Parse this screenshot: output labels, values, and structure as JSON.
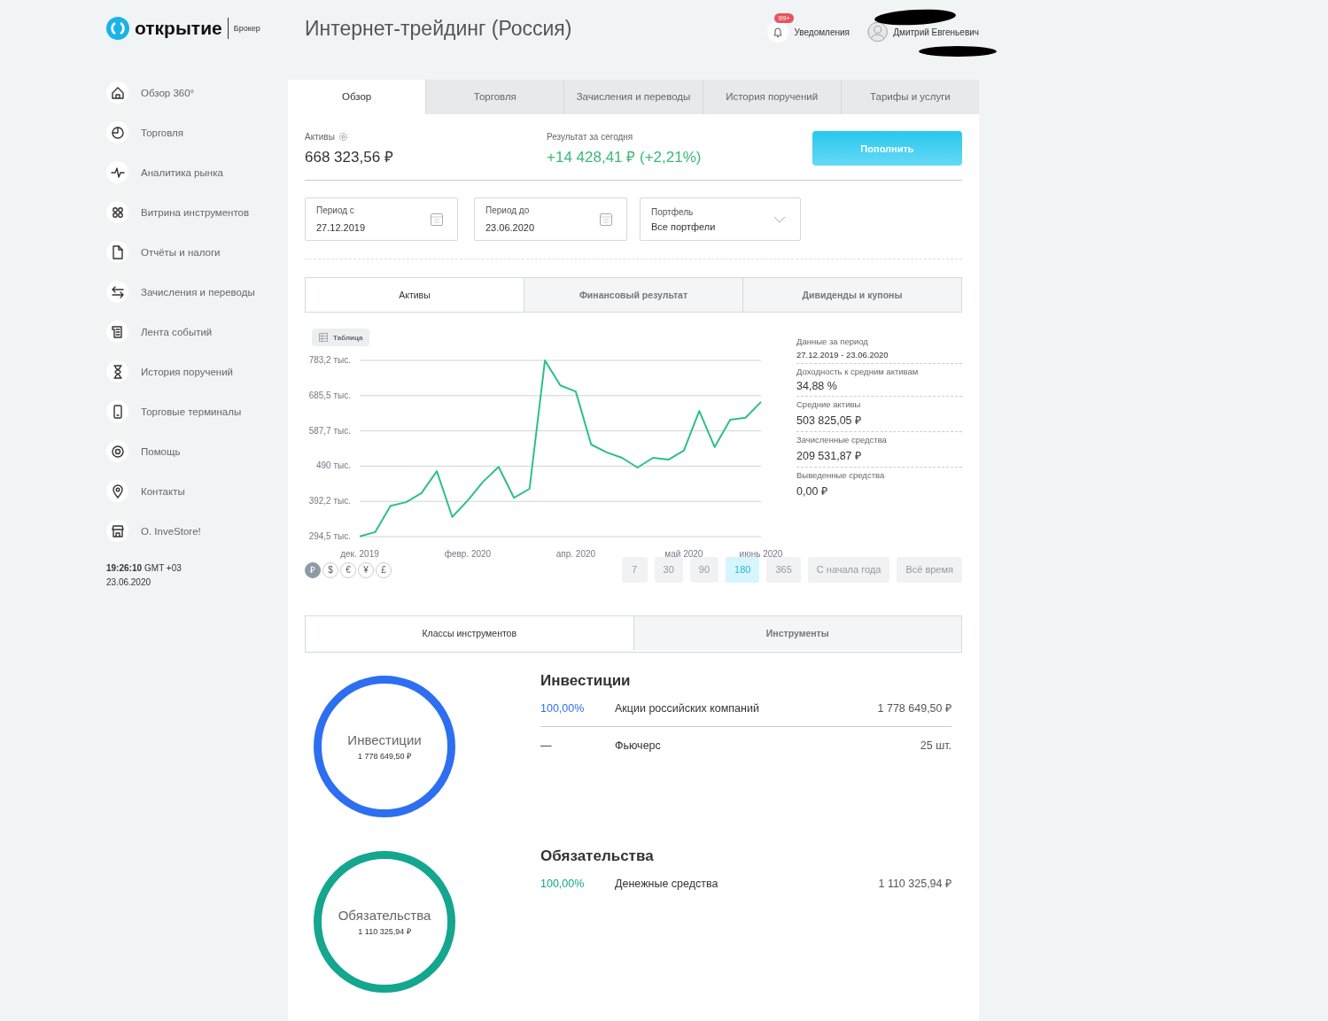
{
  "header": {
    "logo": "открытие",
    "logo_sub": "Брокер",
    "title": "Интернет-трейдинг (Россия)",
    "notifications": {
      "badge": "99+",
      "label": "Уведомления"
    },
    "user": {
      "name": "Дмитрий Евгеньевич"
    }
  },
  "sidebar": {
    "items": [
      {
        "label": "Обзор 360°"
      },
      {
        "label": "Торговля"
      },
      {
        "label": "Аналитика рынка"
      },
      {
        "label": "Витрина инструментов"
      },
      {
        "label": "Отчёты и налоги"
      },
      {
        "label": "Зачисления и переводы"
      },
      {
        "label": "Лента событий"
      },
      {
        "label": "История поручений"
      },
      {
        "label": "Торговые терминалы"
      },
      {
        "label": "Помощь"
      },
      {
        "label": "Контакты"
      },
      {
        "label": "O. InveStore!"
      }
    ],
    "time": "19:26:10",
    "zone": "GMT +03",
    "date": "23.06.2020"
  },
  "tabs": [
    {
      "label": "Обзор",
      "selected": true
    },
    {
      "label": "Торговля",
      "selected": false
    },
    {
      "label": "Зачисления и переводы",
      "selected": false
    },
    {
      "label": "История поручений",
      "selected": false
    },
    {
      "label": "Тарифы и услуги",
      "selected": false
    }
  ],
  "summary": {
    "assets_label": "Активы",
    "assets": "668 323,56 ₽",
    "result_label": "Результат за сегодня",
    "result": "+14 428,41 ₽  (+2,21%)",
    "button": "Пополнить"
  },
  "filters": [
    {
      "kind": "date",
      "label": "Период с",
      "value": "27.12.2019"
    },
    {
      "kind": "date",
      "label": "Период до",
      "value": "23.06.2020"
    },
    {
      "kind": "select",
      "label": "Портфель",
      "value": "Все портфели"
    }
  ],
  "chart_tabs": [
    {
      "label": "Активы",
      "selected": true
    },
    {
      "label": "Финансовый результат",
      "selected": false
    },
    {
      "label": "Дивиденды и купоны",
      "selected": false
    }
  ],
  "table_toggle": "Таблица",
  "chart_data": {
    "type": "line",
    "categories": [
      "дек. 2019",
      null,
      null,
      null,
      null,
      null,
      null,
      "февр. 2020",
      null,
      null,
      null,
      null,
      null,
      null,
      "апр. 2020",
      null,
      null,
      null,
      null,
      null,
      null,
      "май 2020",
      null,
      null,
      null,
      null,
      "июнь 2020"
    ],
    "values": [
      295,
      307,
      380,
      390,
      415,
      476,
      349,
      395,
      447,
      488,
      402,
      427,
      783,
      714,
      697,
      550,
      528,
      513,
      486,
      513,
      508,
      533,
      643,
      543,
      619,
      624,
      668
    ],
    "ylim": [
      294.5,
      783.2
    ],
    "grid": true,
    "yticks": [
      {
        "value": 294.5,
        "label": "294,5 тыс."
      },
      {
        "value": 392.2,
        "label": "392,2 тыс."
      },
      {
        "value": 490,
        "label": "490 тыс."
      },
      {
        "value": 587.7,
        "label": "587,7 тыс."
      },
      {
        "value": 685.5,
        "label": "685,5 тыс."
      },
      {
        "value": 783.2,
        "label": "783,2 тыс."
      }
    ]
  },
  "stats": [
    {
      "label": "Данные за период",
      "value": "27.12.2019 - 23.06.2020",
      "kind": "small"
    },
    {
      "label": "Доходность к средним активам",
      "value": "34,88 %",
      "kind": "big"
    },
    {
      "label": "Средние активы",
      "value": "503 825,05 ₽",
      "kind": "big"
    },
    {
      "label": "Зачисленные средства",
      "value": "209 531,87 ₽",
      "kind": "big"
    },
    {
      "label": "Выведенные средства",
      "value": "0,00 ₽",
      "kind": "big"
    }
  ],
  "currencies": [
    {
      "label": "₽",
      "selected": true
    },
    {
      "label": "$",
      "selected": false
    },
    {
      "label": "€",
      "selected": false
    },
    {
      "label": "¥",
      "selected": false
    },
    {
      "label": "£",
      "selected": false
    }
  ],
  "periods": [
    {
      "label": "7",
      "selected": false
    },
    {
      "label": "30",
      "selected": false
    },
    {
      "label": "90",
      "selected": false
    },
    {
      "label": "180",
      "selected": true
    },
    {
      "label": "365",
      "selected": false
    },
    {
      "label": "С начала года",
      "selected": false
    },
    {
      "label": "Всё время",
      "selected": false
    }
  ],
  "class_tabs": [
    {
      "label": "Классы инструментов",
      "selected": true
    },
    {
      "label": "Инструменты",
      "selected": false
    }
  ],
  "groups": [
    {
      "title": "Инвестиции",
      "ring_label": "Инвестиции",
      "ring_value": "1 778 649,50 ₽",
      "color": "#2d6ff0",
      "rows": [
        {
          "share": "100,00%",
          "name": "Акции российских компаний",
          "amount": "1 778 649,50 ₽"
        },
        {
          "share": "—",
          "name": "Фьючерс",
          "amount": "25 шт."
        }
      ]
    },
    {
      "title": "Обязательства",
      "ring_label": "Обязательства",
      "ring_value": "1 110 325,94 ₽",
      "color": "#14a68f",
      "rows": [
        {
          "share": "100,00%",
          "name": "Денежные средства",
          "amount": "1 110 325,94 ₽"
        }
      ]
    }
  ]
}
